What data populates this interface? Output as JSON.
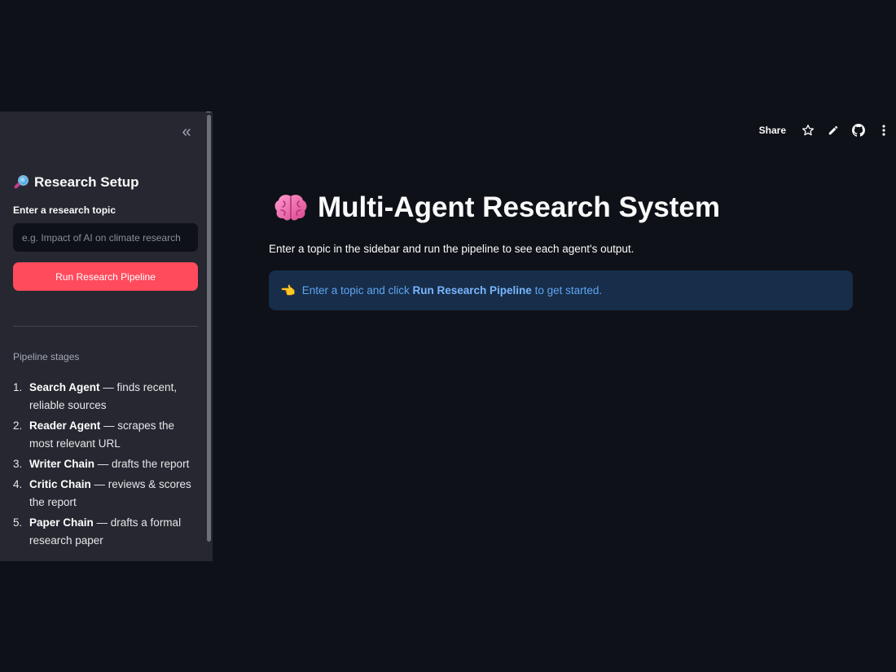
{
  "sidebar": {
    "title": "Research Setup",
    "topic_label": "Enter a research topic",
    "topic_placeholder": "e.g. Impact of AI on climate research",
    "topic_value": "",
    "run_button": "Run Research Pipeline",
    "stages_caption": "Pipeline stages",
    "stages": [
      {
        "num": "1.",
        "name": "Search Agent",
        "desc": " — finds recent, reliable sources"
      },
      {
        "num": "2.",
        "name": "Reader Agent",
        "desc": " — scrapes the most relevant URL"
      },
      {
        "num": "3.",
        "name": "Writer Chain",
        "desc": " — drafts the report"
      },
      {
        "num": "4.",
        "name": "Critic Chain",
        "desc": " — reviews & scores the report"
      },
      {
        "num": "5.",
        "name": "Paper Chain",
        "desc": " — drafts a formal research paper"
      }
    ]
  },
  "toolbar": {
    "share": "Share",
    "icons": [
      "star-icon",
      "pencil-icon",
      "github-icon",
      "more-vertical-icon"
    ]
  },
  "main": {
    "title": "Multi-Agent Research System",
    "description": "Enter a topic in the sidebar and run the pipeline to see each agent's output.",
    "info": {
      "prefix": "Enter a topic and click ",
      "bold": "Run Research Pipeline",
      "suffix": " to get started."
    }
  },
  "colors": {
    "background": "#0e1117",
    "sidebar": "#262730",
    "primary_button": "#ff4b5c",
    "info_bg": "#172d49",
    "info_text": "#5fa5f2"
  }
}
